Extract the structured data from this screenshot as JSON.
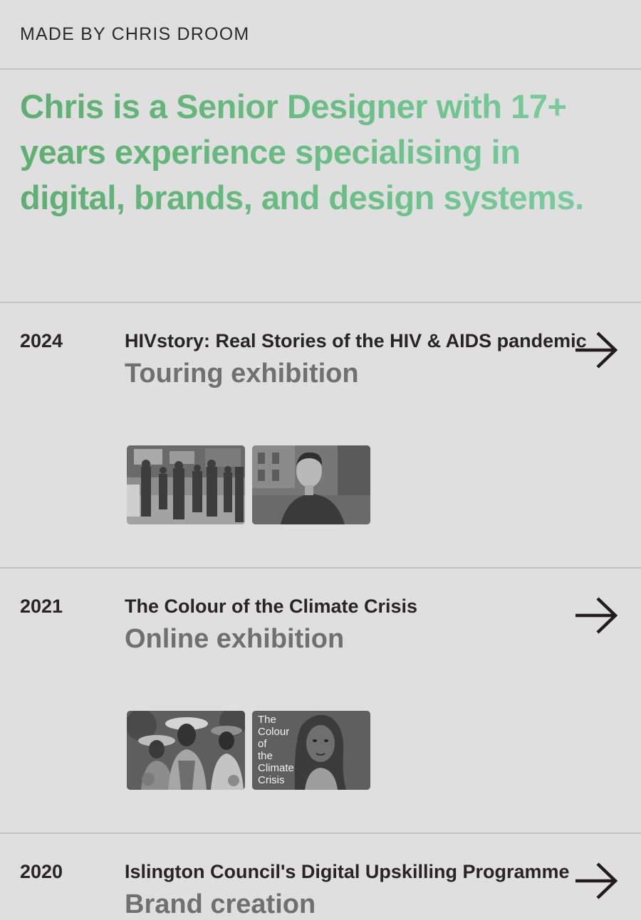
{
  "header": {
    "site_title": "MADE BY CHRIS DROOM"
  },
  "intro": {
    "text": "Chris is a Senior Designer with 17+ years experience specialising in digital, brands, and design systems.",
    "gradient_colors": [
      "#5fae72",
      "#7dcfa4"
    ]
  },
  "projects": [
    {
      "year": "2024",
      "title": "HIVstory: Real Stories of the HIV & AIDS pandemic",
      "type": "Touring exhibition",
      "thumbnails": [
        {
          "name": "crowd-photo"
        },
        {
          "name": "portrait-photo"
        }
      ]
    },
    {
      "year": "2021",
      "title": "The Colour of the Climate Crisis",
      "type": "Online exhibition",
      "thumbnails": [
        {
          "name": "women-with-hats-illustration"
        },
        {
          "name": "climate-crisis-poster",
          "caption_lines": [
            "The",
            "Colour",
            "of",
            "the",
            "Climate",
            "Crisis"
          ]
        }
      ]
    },
    {
      "year": "2020",
      "title": "Islington Council's Digital Upskilling Programme",
      "type": "Brand creation"
    }
  ],
  "icons": {
    "arrow": "arrow-right-icon"
  },
  "colors": {
    "background": "#dfdfdf",
    "divider": "#c3c3c3",
    "text_dark": "#2a2428",
    "text_muted": "#707070"
  }
}
